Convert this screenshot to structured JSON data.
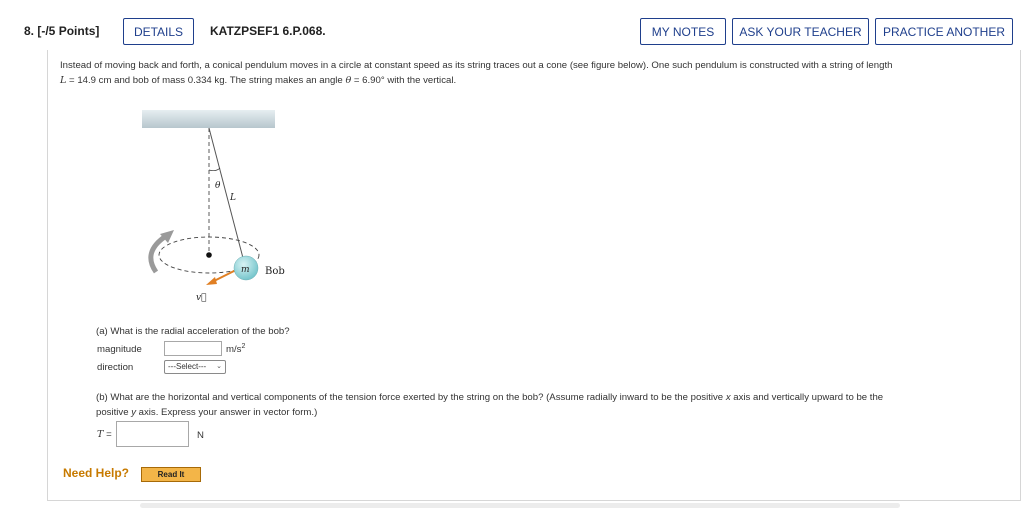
{
  "question": {
    "number": "8.",
    "points": "[-/5 Points]",
    "details_label": "DETAILS",
    "code": "KATZPSEF1 6.P.068."
  },
  "toolbar": {
    "my_notes": "MY NOTES",
    "ask_teacher": "ASK YOUR TEACHER",
    "practice_another": "PRACTICE ANOTHER"
  },
  "intro": {
    "line1": "Instead of moving back and forth, a conical pendulum moves in a circle at constant speed as its string traces out a cone (see figure below). One such pendulum is constructed with a string of length",
    "l_symbol": "L",
    "l_equals": " = ",
    "l_value": "14.9",
    "l_unit": " cm",
    "mid_text": " and bob of mass ",
    "mass_value": "0.334",
    "mass_unit": " kg. The string makes an angle ",
    "theta_symbol": "θ",
    "theta_equals": " = ",
    "theta_value": "6.90°",
    "end_text": " with the vertical."
  },
  "figure": {
    "theta_label": "θ",
    "length_label": "L",
    "mass_label": "m",
    "bob_label": "Bob",
    "velocity_label": "v⃗",
    "colors": {
      "ceiling": "#c9d6dc",
      "bob": "#8fd3d8",
      "velocity_arrow": "#e07f23",
      "rotation_arrow": "#999999"
    }
  },
  "part_a": {
    "prompt": "(a) What is the radial acceleration of the bob?",
    "magnitude_label": "magnitude",
    "magnitude_value": "",
    "unit": "m/s",
    "unit_exp": "2",
    "direction_label": "direction",
    "direction_selected": "---Select---"
  },
  "part_b": {
    "prompt_1": "(b) What are the horizontal and vertical components of the tension force exerted by the string on the bob? (Assume radially inward to be the positive ",
    "x_symbol": "x",
    "prompt_2": " axis and vertically upward to be the",
    "prompt_3": "positive ",
    "y_symbol": "y",
    "prompt_4": " axis. Express your answer in vector form.)",
    "t_label": "T",
    "t_equals": " =",
    "t_value": "",
    "unit": "N"
  },
  "help": {
    "need_help": "Need Help?",
    "read_it": "Read It"
  }
}
